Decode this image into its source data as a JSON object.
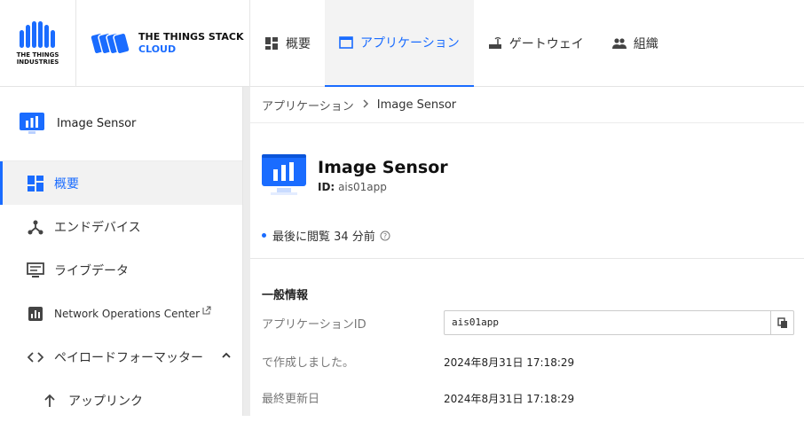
{
  "brand": {
    "tti_line1": "THE THINGS",
    "tti_line2": "INDUSTRIES",
    "stack_line1": "THE THINGS STACK",
    "stack_line2": "CLOUD"
  },
  "nav": {
    "overview": "概要",
    "applications": "アプリケーション",
    "gateways": "ゲートウェイ",
    "organizations": "組織"
  },
  "sidebar": {
    "app_name": "Image Sensor",
    "items": [
      {
        "label": "概要",
        "icon": "dashboard-icon"
      },
      {
        "label": "エンドデバイス",
        "icon": "device-hub-icon"
      },
      {
        "label": "ライブデータ",
        "icon": "live-data-icon"
      },
      {
        "label": "Network Operations Center",
        "icon": "bar-chart-icon"
      },
      {
        "label": "ペイロードフォーマッター",
        "icon": "code-icon"
      },
      {
        "label": "アップリンク",
        "icon": "arrow-up-icon"
      }
    ]
  },
  "breadcrumb": {
    "root": "アプリケーション",
    "current": "Image Sensor"
  },
  "header": {
    "title": "Image Sensor",
    "id_label": "ID:",
    "id_value": "ais01app"
  },
  "last_seen": "最後に閲覧 34 分前",
  "general": {
    "section_title": "一般情報",
    "app_id_label": "アプリケーションID",
    "app_id_value": "ais01app",
    "created_label": "で作成しました。",
    "created_value": "2024年8月31日 17:18:29",
    "updated_label": "最終更新日",
    "updated_value": "2024年8月31日 17:18:29"
  },
  "colors": {
    "accent": "#1a6cff"
  }
}
